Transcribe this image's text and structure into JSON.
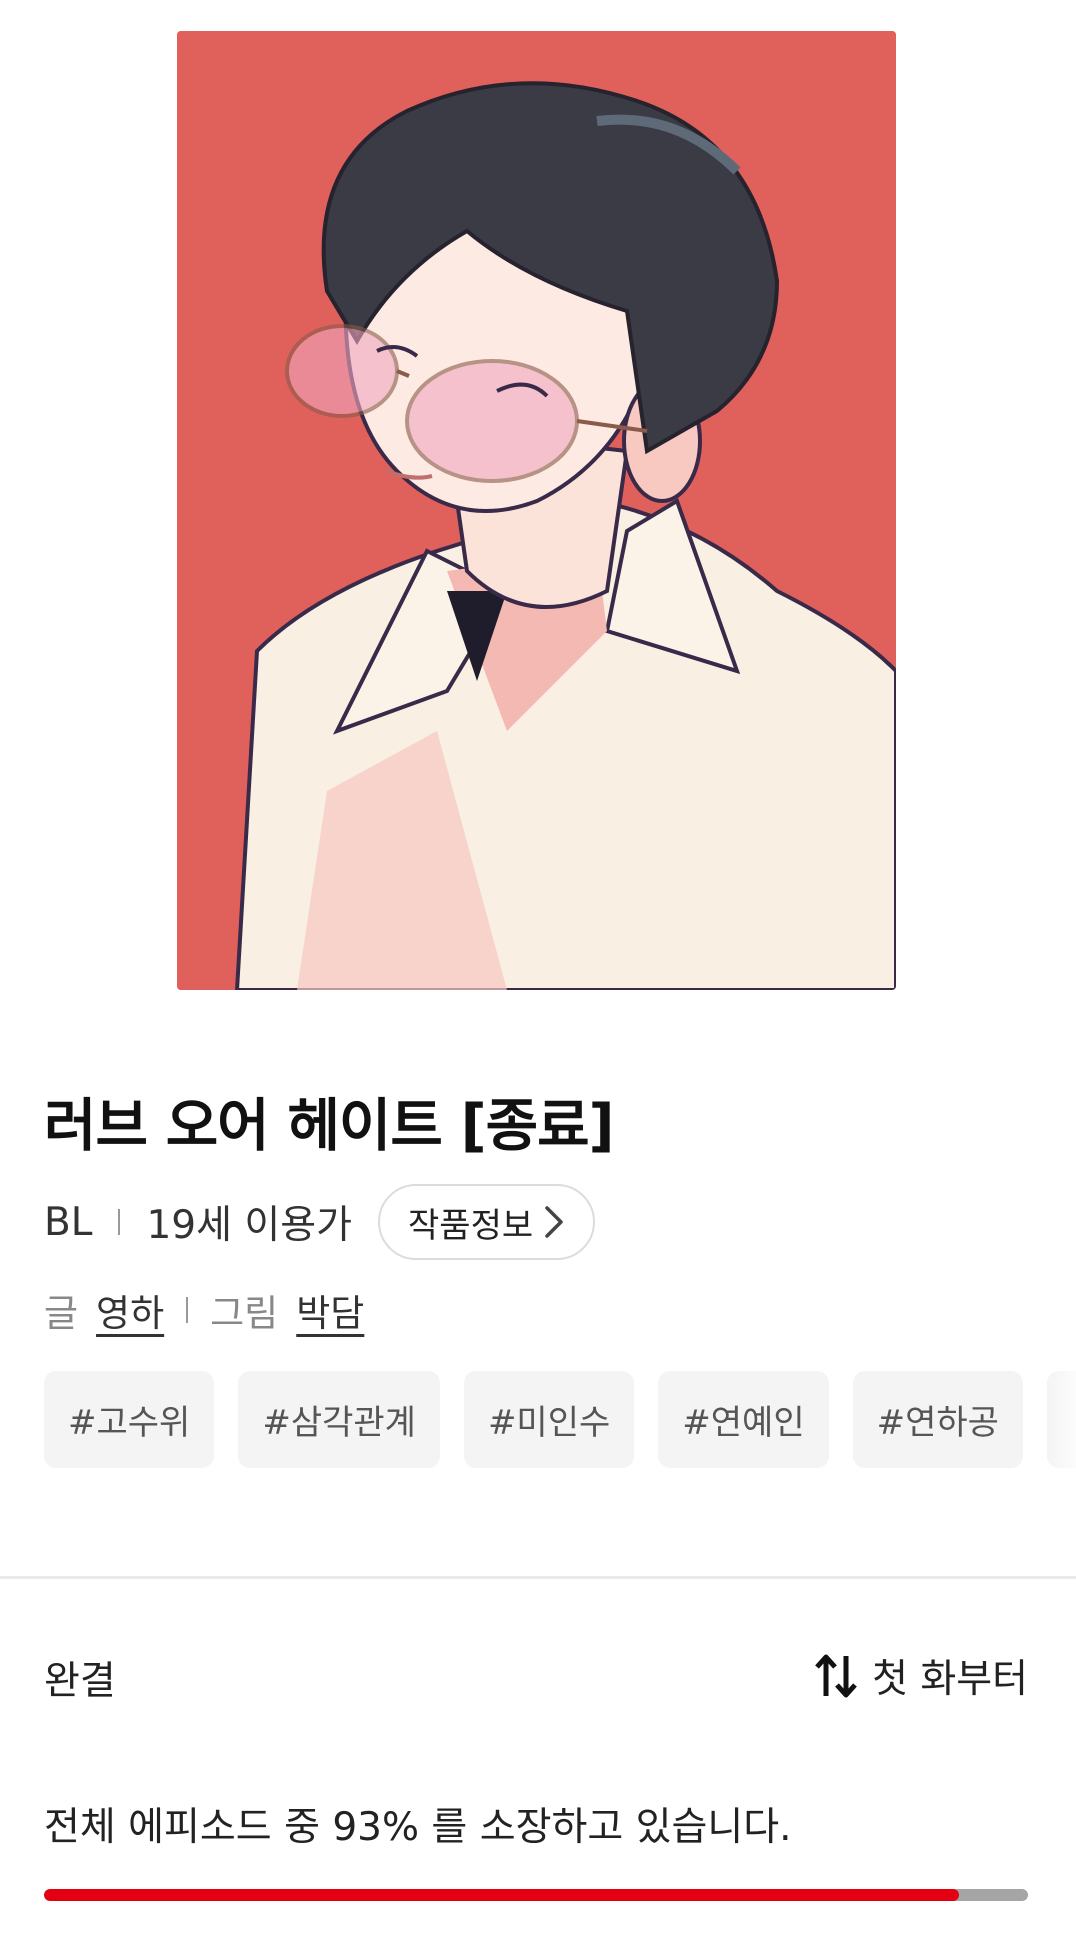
{
  "cover": {
    "alt_icon": "cover-illustration",
    "background": "#e0615b"
  },
  "title": "러브 오어 헤이트 [종료]",
  "meta": {
    "genre": "BL",
    "age_rating": "19세 이용가",
    "info_button": "작품정보"
  },
  "credits": {
    "writer_label": "글",
    "writer_name": "영하",
    "artist_label": "그림",
    "artist_name": "박담"
  },
  "tags": [
    "#고수위",
    "#삼각관계",
    "#미인수",
    "#연예인",
    "#연하공"
  ],
  "episodes": {
    "status": "완결",
    "sort_label": "첫 화부터",
    "owned_text": "전체 에피소드 중 93% 를 소장하고 있습니다.",
    "owned_percent": 93
  },
  "colors": {
    "accent": "#e40012",
    "progress_track": "#a5a5a5",
    "tag_bg": "#f4f4f4"
  }
}
